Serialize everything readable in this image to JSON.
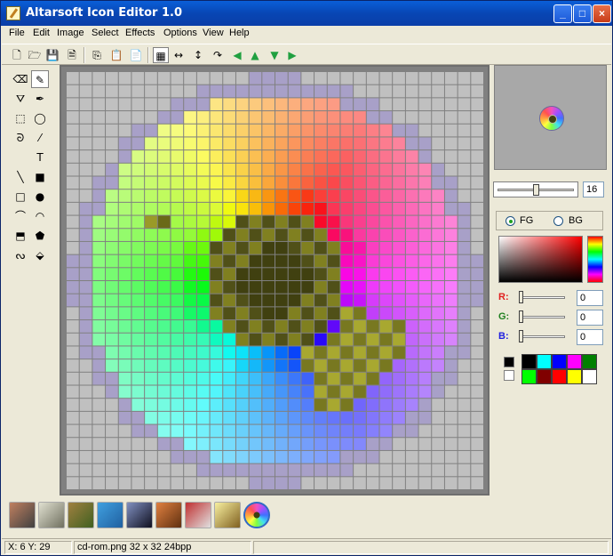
{
  "window": {
    "title": "Altarsoft Icon Editor 1.0",
    "controls": [
      "_",
      "□",
      "×"
    ]
  },
  "menu": [
    "File",
    "Edit",
    "Image",
    "Select",
    "Effects",
    "Options",
    "View",
    "Help"
  ],
  "toolbar": [
    {
      "name": "new-icon",
      "glyph": "🗋"
    },
    {
      "name": "open-icon",
      "glyph": "🗁"
    },
    {
      "name": "save-icon",
      "glyph": "💾"
    },
    {
      "name": "save-as-icon",
      "glyph": "🗎"
    },
    {
      "name": "copy-icon",
      "glyph": "⎘"
    },
    {
      "name": "paste-icon",
      "glyph": "📋"
    },
    {
      "name": "paste-special-icon",
      "glyph": "📄"
    },
    {
      "name": "grid-icon",
      "glyph": "▦"
    },
    {
      "name": "flip-horizontal-icon",
      "glyph": "↔"
    },
    {
      "name": "flip-vertical-icon",
      "glyph": "↕"
    },
    {
      "name": "rotate-icon",
      "glyph": "↷"
    },
    {
      "name": "shift-left-icon",
      "glyph": "◀"
    },
    {
      "name": "shift-up-icon",
      "glyph": "▲"
    },
    {
      "name": "shift-down-icon",
      "glyph": "▼"
    },
    {
      "name": "shift-right-icon",
      "glyph": "▶"
    }
  ],
  "tools": [
    {
      "name": "eraser-tool",
      "glyph": "⌫"
    },
    {
      "name": "pencil-tool",
      "glyph": "✎",
      "active": true
    },
    {
      "name": "fill-tool",
      "glyph": "⛛"
    },
    {
      "name": "eyedropper-tool",
      "glyph": "✒"
    },
    {
      "name": "rect-select-tool",
      "glyph": "⬚"
    },
    {
      "name": "ellipse-select-tool",
      "glyph": "◯"
    },
    {
      "name": "lasso-tool",
      "glyph": "ᘐ"
    },
    {
      "name": "brush-tool",
      "glyph": "⁄"
    },
    {
      "name": "blank-tool",
      "glyph": ""
    },
    {
      "name": "text-tool",
      "glyph": "T"
    },
    {
      "name": "line-tool",
      "glyph": "╲"
    },
    {
      "name": "filled-rect-tool",
      "glyph": "■"
    },
    {
      "name": "rect-tool",
      "glyph": "□"
    },
    {
      "name": "filled-ellipse-tool",
      "glyph": "●"
    },
    {
      "name": "arc-tool",
      "glyph": "⌒"
    },
    {
      "name": "filled-arc-tool",
      "glyph": "◠"
    },
    {
      "name": "polygon-tool",
      "glyph": "⬒"
    },
    {
      "name": "filled-polygon-tool",
      "glyph": "⬟"
    },
    {
      "name": "curve-tool",
      "glyph": "ᔓ"
    },
    {
      "name": "stamp-tool",
      "glyph": "⬙"
    }
  ],
  "preview": {
    "zoom_value": "16",
    "zoom_fraction": 0.5
  },
  "color_mode": {
    "fg_label": "FG",
    "bg_label": "BG",
    "selected": "FG"
  },
  "rgb": [
    {
      "label": "R:",
      "value": "0",
      "color": "#e02020"
    },
    {
      "label": "G:",
      "value": "0",
      "color": "#208020"
    },
    {
      "label": "B:",
      "value": "0",
      "color": "#2020e0"
    }
  ],
  "fg_color": "#000000",
  "bg_color": "#ffffff",
  "swatches": [
    "#000000",
    "#00ffff",
    "#0000ff",
    "#ff00ff",
    "#008000",
    "#00ff00",
    "#800000",
    "#ff0000",
    "#ffff00",
    "#ffffff"
  ],
  "open_icons": [
    {
      "name": "person-thumb-icon",
      "colors": [
        "#c08060",
        "#404040"
      ]
    },
    {
      "name": "elephant-thumb-icon",
      "colors": [
        "#e0e0d0",
        "#707060"
      ]
    },
    {
      "name": "animal-thumb-icon",
      "colors": [
        "#a08040",
        "#406020"
      ]
    },
    {
      "name": "ocean-thumb-icon",
      "colors": [
        "#40a0e0",
        "#2060a0"
      ]
    },
    {
      "name": "planet-thumb-icon",
      "colors": [
        "#8090c0",
        "#101020"
      ]
    },
    {
      "name": "cat-thumb-icon",
      "colors": [
        "#e08040",
        "#603010"
      ]
    },
    {
      "name": "book-thumb-icon",
      "colors": [
        "#c03030",
        "#e0e0e0"
      ]
    },
    {
      "name": "pencil-thumb-icon",
      "colors": [
        "#f8f0a0",
        "#806020"
      ]
    },
    {
      "name": "cd-rom-thumb-icon",
      "colors": [
        "#f050c0",
        "#40e0f0"
      ],
      "selected": true
    }
  ],
  "status": {
    "coords": "X: 6 Y: 29",
    "file_info": "cd-rom.png 32 x 32 24bpp"
  },
  "image": {
    "width": 32,
    "height": 32,
    "background": "#c0c0c0",
    "description_colors": {
      "hole": "#404010",
      "hub": "#808020",
      "olive": "#a0a020"
    }
  }
}
